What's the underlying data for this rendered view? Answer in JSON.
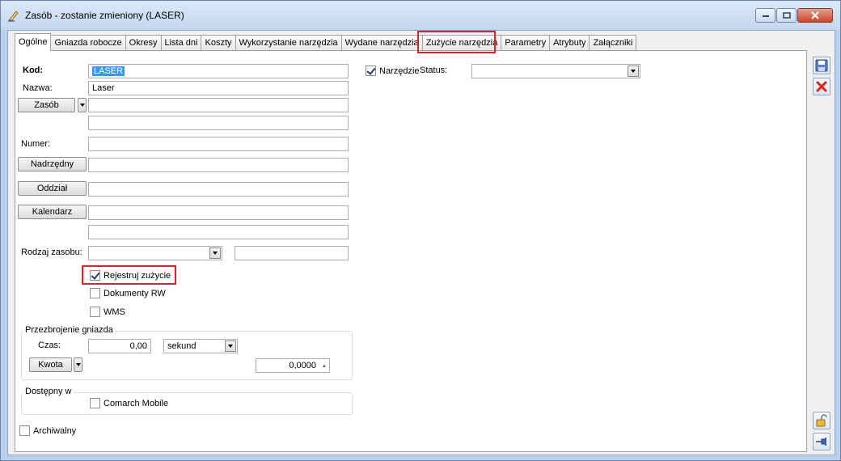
{
  "window": {
    "title": "Zasób - zostanie zmieniony  (LASER)"
  },
  "tabs": [
    {
      "label": "Ogólne",
      "active": true
    },
    {
      "label": "Gniazda robocze"
    },
    {
      "label": "Okresy"
    },
    {
      "label": "Lista dni"
    },
    {
      "label": "Koszty"
    },
    {
      "label": "Wykorzystanie narzędzia"
    },
    {
      "label": "Wydane narzędzia"
    },
    {
      "label": "Zużycie narzędzia"
    },
    {
      "label": "Parametry"
    },
    {
      "label": "Atrybuty"
    },
    {
      "label": "Załączniki"
    }
  ],
  "form": {
    "kod_label": "Kod:",
    "kod_value": "LASER",
    "nazwa_label": "Nazwa:",
    "nazwa_value": "Laser",
    "zasob_button": "Zasób",
    "zasob_value": "",
    "zasob_value2": "",
    "numer_label": "Numer:",
    "numer_value": "",
    "nadrzedny_button": "Nadrzędny",
    "oddzial_button": "Oddział",
    "kalendarz_button": "Kalendarz",
    "rodzaj_label": "Rodzaj zasobu:",
    "rodzaj_value": "",
    "rejestruj_label": "Rejestruj zużycie",
    "rejestruj_checked": true,
    "dokumenty_label": "Dokumenty RW",
    "dokumenty_checked": false,
    "wms_label": "WMS",
    "wms_checked": false,
    "przezbrojenie_title": "Przezbrojenie gniazda",
    "czas_label": "Czas:",
    "czas_value": "0,00",
    "czas_unit": "sekund",
    "kwota_button": "Kwota",
    "kwota_value": "0,0000",
    "dostepny_title": "Dostępny w",
    "comarch_label": "Comarch Mobile",
    "comarch_checked": false,
    "archiwalny_label": "Archiwalny",
    "archiwalny_checked": false,
    "narzedzie_label": "Narzędzie",
    "narzedzie_checked": true,
    "status_label": "Status:",
    "status_value": ""
  },
  "colors": {
    "highlight": "#e2222a",
    "selection": "#3399ff"
  },
  "icons": [
    "edit-icon",
    "minimize-icon",
    "maximize-icon",
    "close-icon",
    "save-icon",
    "cancel-icon",
    "lock-icon",
    "pin-icon"
  ]
}
